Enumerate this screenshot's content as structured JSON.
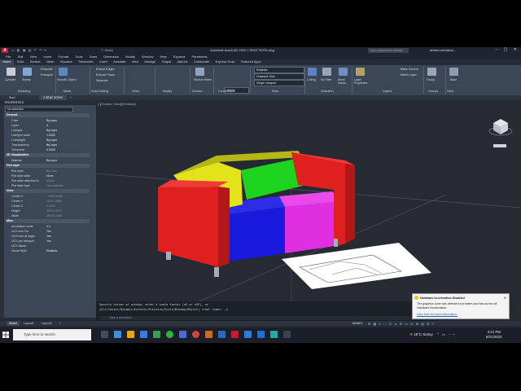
{
  "window": {
    "title": "Autodesk AutoCAD 2022   2 SEAT SOFA.dwg",
    "app_icon": "A",
    "share_label": "Share",
    "search_placeholder": "Type a keyword or phrase",
    "user": "amilan.debabrat..."
  },
  "menubar": [
    "File",
    "Edit",
    "View",
    "Insert",
    "Format",
    "Tools",
    "Draw",
    "Dimension",
    "Modify",
    "Window",
    "Help",
    "Express",
    "Parametric"
  ],
  "ribbon_tabs": [
    "Home",
    "Solid",
    "Surface",
    "Mesh",
    "Visualize",
    "Parametric",
    "Insert",
    "Annotate",
    "View",
    "Manage",
    "Output",
    "Add-ins",
    "Collaborate",
    "Express Tools",
    "Featured Apps"
  ],
  "ribbon": {
    "cylinder": "Cylinder",
    "sweep": "Sweep",
    "polysolid": "Polysolid",
    "presspull": "Presspull",
    "smooth_object": "Smooth Object",
    "extract_edges": "Extract Edges",
    "extrude_faces": "Extrude Faces",
    "separate": "Separate",
    "section_plane": "Section Plane",
    "culling": "Culling",
    "no_filter": "No Filter",
    "move_gizmo": "Move Gizmo",
    "layer_properties": "Layer Properties",
    "visual_style": "Realistic",
    "view": "Unsaved View",
    "world": "World",
    "viewport": "Single viewport",
    "make_current": "Make Current",
    "match_layer": "Match Layer",
    "group": "Group",
    "base": "Base",
    "panels": [
      "Modeling",
      "Mesh",
      "Solid Editing",
      "Draw",
      "Modify",
      "Section",
      "Coordinates",
      "View",
      "Selection",
      "Layers",
      "Groups",
      "View"
    ]
  },
  "doc_tabs": {
    "start": "Start",
    "active": "2 SEAT SOFA*"
  },
  "properties": {
    "header": "PROPERTIES",
    "selection": "No selection",
    "sections": [
      {
        "title": "General",
        "rows": [
          {
            "k": "Color",
            "v": "ByLayer",
            "dim": false
          },
          {
            "k": "Layer",
            "v": "0",
            "dim": false
          },
          {
            "k": "Linetype",
            "v": "ByLayer",
            "dim": false
          },
          {
            "k": "Linetype scale",
            "v": "1.0000",
            "dim": false
          },
          {
            "k": "Lineweight",
            "v": "ByLayer",
            "dim": false
          },
          {
            "k": "Transparency",
            "v": "ByLayer",
            "dim": false
          },
          {
            "k": "Thickness",
            "v": "0.0000",
            "dim": false
          }
        ]
      },
      {
        "title": "3D Visualization",
        "rows": [
          {
            "k": "Material",
            "v": "ByLayer",
            "dim": false
          }
        ]
      },
      {
        "title": "Plot style",
        "rows": [
          {
            "k": "Plot style",
            "v": "ByColor",
            "dim": true
          },
          {
            "k": "Plot style table",
            "v": "None",
            "dim": false
          },
          {
            "k": "Plot table attached to",
            "v": "Model",
            "dim": true
          },
          {
            "k": "Plot table type",
            "v": "Not available",
            "dim": true
          }
        ]
      },
      {
        "title": "View",
        "rows": [
          {
            "k": "Center X",
            "v": "-71697.6426",
            "dim": true
          },
          {
            "k": "Center Y",
            "v": "15011.3660",
            "dim": true
          },
          {
            "k": "Center Z",
            "v": "0.0000",
            "dim": true
          },
          {
            "k": "Height",
            "v": "19972.8737",
            "dim": true
          },
          {
            "k": "Width",
            "v": "45978.1993",
            "dim": true
          }
        ]
      },
      {
        "title": "Misc",
        "rows": [
          {
            "k": "Annotation scale",
            "v": "1:1",
            "dim": false
          },
          {
            "k": "UCS icon On",
            "v": "Yes",
            "dim": false
          },
          {
            "k": "UCS icon at origin",
            "v": "Yes",
            "dim": false
          },
          {
            "k": "UCS per viewport",
            "v": "Yes",
            "dim": false
          },
          {
            "k": "UCS Name",
            "v": "",
            "dim": false
          },
          {
            "k": "Visual Style",
            "v": "Realistic",
            "dim": false
          }
        ]
      }
    ]
  },
  "viewport_label": "[-][Custom View][Realistic]",
  "command": {
    "line1": "Specify corner of window, enter a scale factor (nX or nXP), or",
    "line2": "[All/Center/Dynamic/Extents/Previous/Scale/Window/Object] <real time>: _e",
    "placeholder": "Type a command"
  },
  "notification": {
    "title": "Hardware Acceleration Disabled",
    "message": "The graphics tuner has detected a problem and has turned off Hardware Acceleration.",
    "link": "Click here for more information."
  },
  "layout_tabs": [
    "Model",
    "Layout1",
    "Layout2"
  ],
  "status_model": "MODEL",
  "taskbar": {
    "search_placeholder": "Type here to search",
    "weather": "18°C  Sunny",
    "time": "2:21 PM",
    "date": "6/21/2022"
  },
  "colors": {
    "sofa_red": "#e01f1f",
    "sofa_yellow": "#e3e31c",
    "sofa_green": "#1ed41e",
    "sofa_blue": "#1a1adc",
    "sofa_magenta": "#e02fe0"
  }
}
